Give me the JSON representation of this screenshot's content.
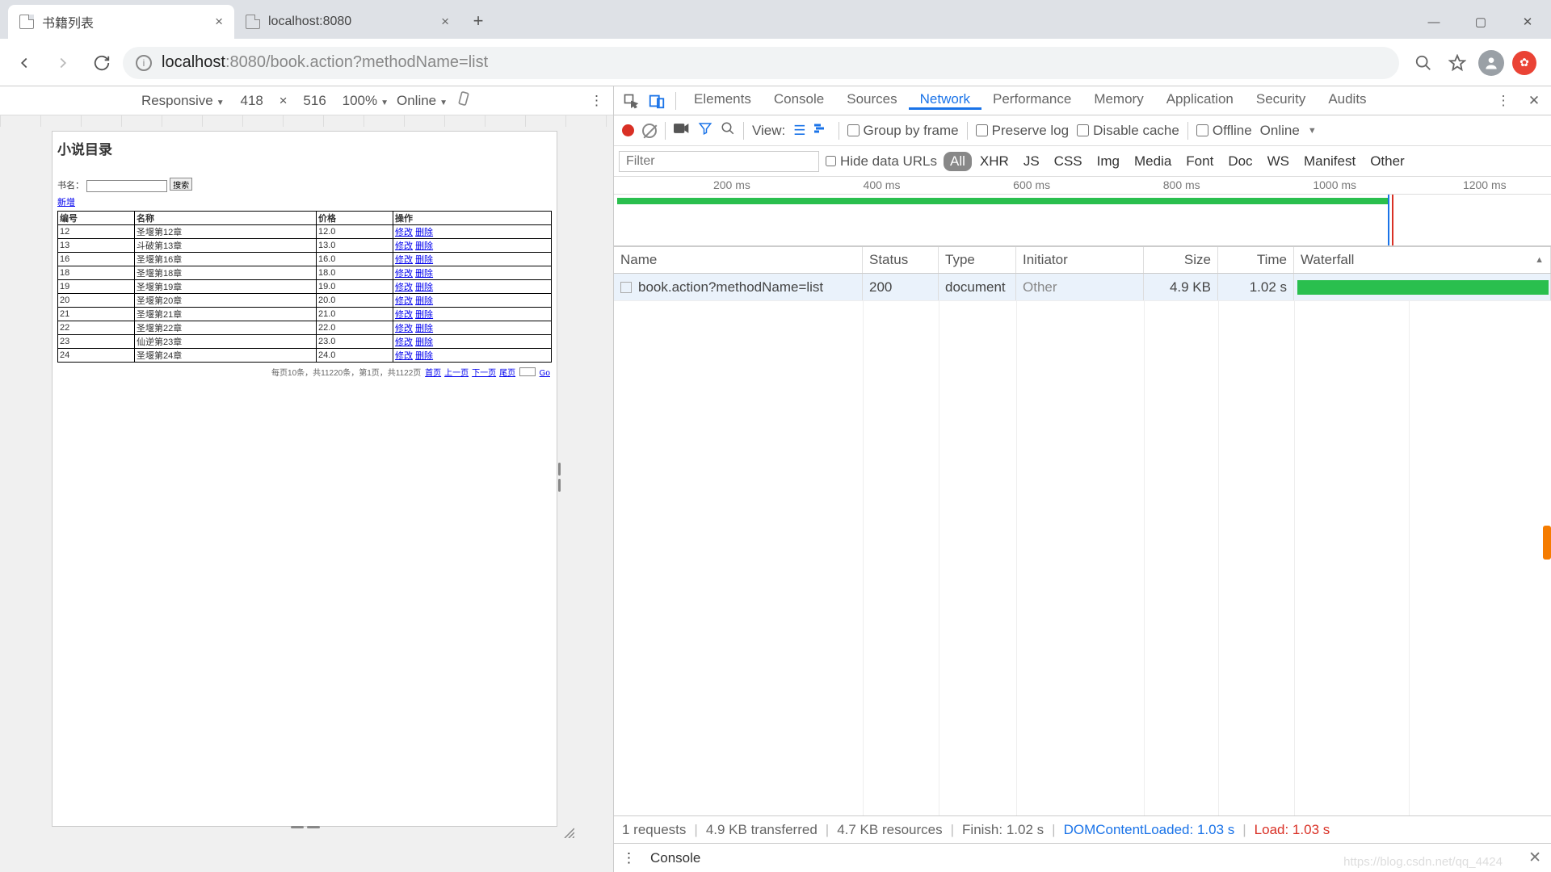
{
  "browser": {
    "tabs": [
      {
        "title": "书籍列表"
      },
      {
        "title": "localhost:8080"
      }
    ],
    "url_host": "localhost",
    "url_port": ":8080",
    "url_path": "/book.action?methodName=list",
    "window_min": "—",
    "window_max": "▢",
    "window_close": "✕"
  },
  "device_toolbar": {
    "device": "Responsive",
    "width": "418",
    "height": "516",
    "times": "×",
    "zoom": "100%",
    "throttle": "Online"
  },
  "sim": {
    "title": "小说目录",
    "book_label": "书名：",
    "search_btn": "搜索",
    "add_link": "新增",
    "cols": [
      "编号",
      "名称",
      "价格",
      "操作"
    ],
    "rows": [
      {
        "id": "12",
        "name": "圣堰第12章",
        "price": "12.0"
      },
      {
        "id": "13",
        "name": "斗破第13章",
        "price": "13.0"
      },
      {
        "id": "16",
        "name": "圣堰第16章",
        "price": "16.0"
      },
      {
        "id": "18",
        "name": "圣堰第18章",
        "price": "18.0"
      },
      {
        "id": "19",
        "name": "圣堰第19章",
        "price": "19.0"
      },
      {
        "id": "20",
        "name": "圣堰第20章",
        "price": "20.0"
      },
      {
        "id": "21",
        "name": "圣堰第21章",
        "price": "21.0"
      },
      {
        "id": "22",
        "name": "圣堰第22章",
        "price": "22.0"
      },
      {
        "id": "23",
        "name": "仙逆第23章",
        "price": "23.0"
      },
      {
        "id": "24",
        "name": "圣堰第24章",
        "price": "24.0"
      }
    ],
    "op_edit": "修改",
    "op_del": "删除",
    "pager_text": "每页10条，共11220条，第1页，共1122页",
    "pager_links": [
      "首页",
      "上一页",
      "下一页",
      "尾页"
    ],
    "go": "Go"
  },
  "devtools": {
    "tabs": [
      "Elements",
      "Console",
      "Sources",
      "Network",
      "Performance",
      "Memory",
      "Application",
      "Security",
      "Audits"
    ],
    "active": "Network",
    "network": {
      "view_label": "View:",
      "group_frame": "Group by frame",
      "preserve_log": "Preserve log",
      "disable_cache": "Disable cache",
      "offline": "Offline",
      "online": "Online",
      "filter_placeholder": "Filter",
      "hide_data": "Hide data URLs",
      "types": [
        "All",
        "XHR",
        "JS",
        "CSS",
        "Img",
        "Media",
        "Font",
        "Doc",
        "WS",
        "Manifest",
        "Other"
      ],
      "ruler": [
        "200 ms",
        "400 ms",
        "600 ms",
        "800 ms",
        "1000 ms",
        "1200 ms"
      ],
      "cols": [
        "Name",
        "Status",
        "Type",
        "Initiator",
        "Size",
        "Time",
        "Waterfall"
      ],
      "row": {
        "name": "book.action?methodName=list",
        "status": "200",
        "type": "document",
        "initiator": "Other",
        "size": "4.9 KB",
        "time": "1.02 s"
      },
      "summary": {
        "requests": "1 requests",
        "transferred": "4.9 KB transferred",
        "resources": "4.7 KB resources",
        "finish": "Finish: 1.02 s",
        "dcl": "DOMContentLoaded: 1.03 s",
        "load": "Load: 1.03 s"
      }
    },
    "drawer": "Console"
  }
}
